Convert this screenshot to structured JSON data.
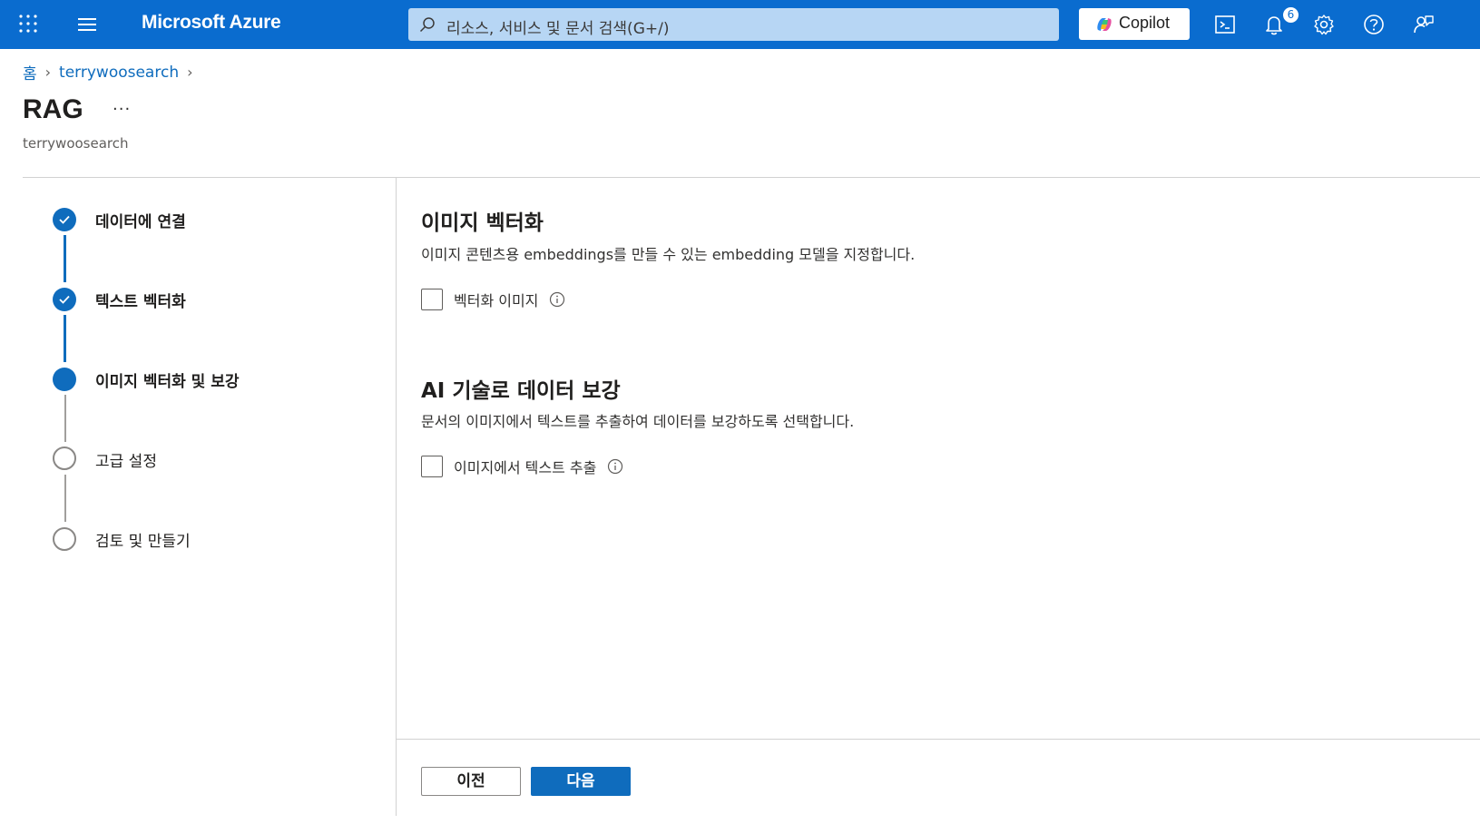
{
  "topbar": {
    "brand": "Microsoft Azure",
    "search_placeholder": "리소스, 서비스 및 문서 검색(G+/)",
    "copilot_label": "Copilot",
    "notification_count": "6",
    "accent_color": "#0a6ccf"
  },
  "breadcrumb": {
    "home": "홈",
    "resource": "terrywoosearch"
  },
  "page": {
    "title": "RAG",
    "more": "···",
    "subtitle": "terrywoosearch"
  },
  "steps": [
    {
      "label": "데이터에 연결",
      "state": "done"
    },
    {
      "label": "텍스트 벡터화",
      "state": "done"
    },
    {
      "label": "이미지 벡터화 및 보강",
      "state": "active"
    },
    {
      "label": "고급 설정",
      "state": "todo"
    },
    {
      "label": "검토 및 만들기",
      "state": "todo"
    }
  ],
  "sections": {
    "image_vectorize": {
      "heading": "이미지 벡터화",
      "description": "이미지 콘텐츠용 embeddings를 만들 수 있는 embedding 모델을 지정합니다.",
      "checkbox_label": "벡터화 이미지",
      "checked": false
    },
    "ai_enrich": {
      "heading": "AI 기술로 데이터 보강",
      "description": "문서의 이미지에서 텍스트를 추출하여 데이터를 보강하도록 선택합니다.",
      "checkbox_label": "이미지에서 텍스트 추출",
      "checked": false
    }
  },
  "footer": {
    "prev_label": "이전",
    "next_label": "다음"
  }
}
